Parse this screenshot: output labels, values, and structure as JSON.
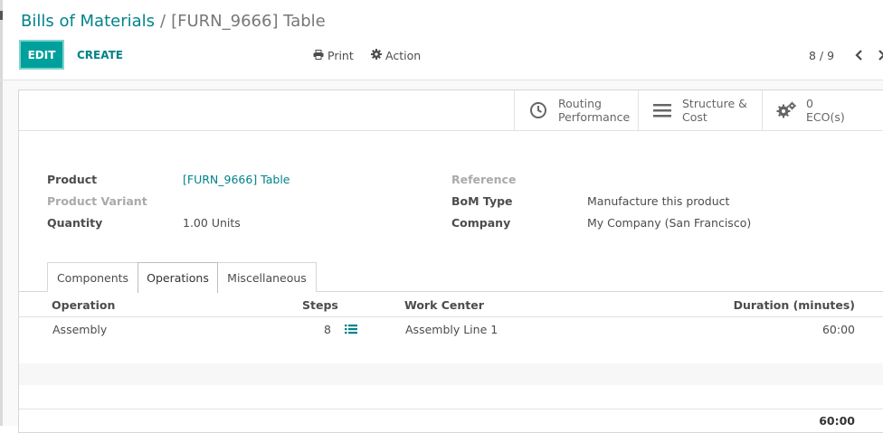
{
  "breadcrumb": {
    "parent": "Bills of Materials",
    "separator": "/",
    "current": "[FURN_9666] Table"
  },
  "toolbar": {
    "edit_label": "EDIT",
    "create_label": "CREATE",
    "print_label": "Print",
    "action_label": "Action"
  },
  "pager": {
    "value": "8 / 9"
  },
  "smart_buttons": {
    "routing": {
      "line1": "Routing",
      "line2": "Performance"
    },
    "structure": {
      "line1": "Structure &",
      "line2": "Cost"
    },
    "eco": {
      "count": "0",
      "label": "ECO(s)"
    }
  },
  "fields": {
    "product_label": "Product",
    "product_value": "[FURN_9666] Table",
    "variant_label": "Product Variant",
    "quantity_label": "Quantity",
    "quantity_value": "1.00",
    "quantity_uom": "Units",
    "reference_label": "Reference",
    "bom_type_label": "BoM Type",
    "bom_type_value": "Manufacture this product",
    "company_label": "Company",
    "company_value": "My Company (San Francisco)"
  },
  "tabs": [
    "Components",
    "Operations",
    "Miscellaneous"
  ],
  "operations": {
    "columns": {
      "operation": "Operation",
      "steps": "Steps",
      "work_center": "Work Center",
      "duration": "Duration (minutes)"
    },
    "rows": [
      {
        "operation": "Assembly",
        "steps": "8",
        "work_center": "Assembly Line 1",
        "duration": "60:00"
      }
    ],
    "total_duration": "60:00"
  },
  "colors": {
    "primary": "#00a09d",
    "link": "#00838a"
  }
}
